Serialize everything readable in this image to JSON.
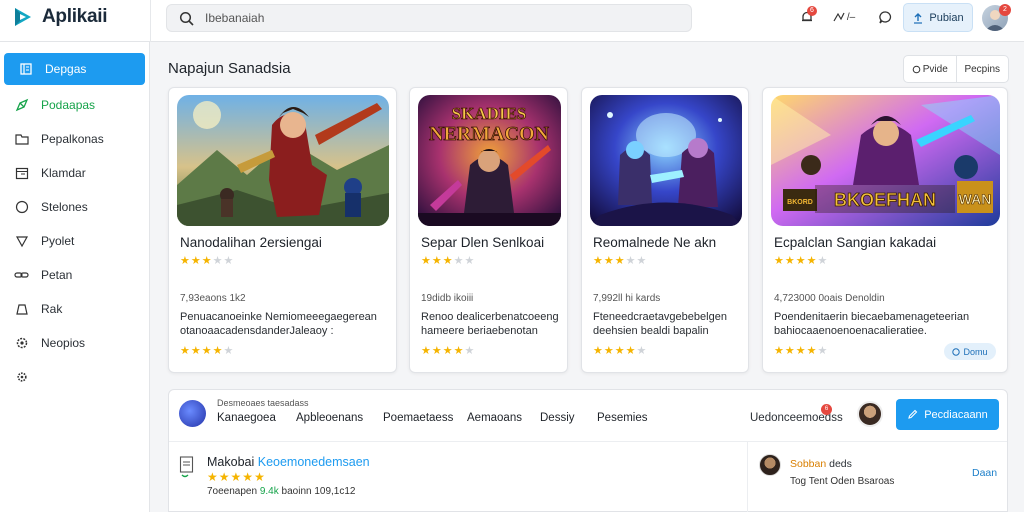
{
  "app": {
    "name": "Aplikaii"
  },
  "search": {
    "placeholder": "Ibebanaiah"
  },
  "topbar": {
    "bell_badge": "6",
    "icon_text": "/–",
    "upload_label": "Pubian",
    "avatar_badge": "2"
  },
  "sidebar": {
    "items": [
      {
        "label": "Depgas",
        "icon": "book-icon"
      },
      {
        "label": "Podaapas",
        "icon": "send-icon"
      },
      {
        "label": "Pepalkonas",
        "icon": "folder-icon"
      },
      {
        "label": "Klamdar",
        "icon": "calendar-icon"
      },
      {
        "label": "Stelones",
        "icon": "circle-icon"
      },
      {
        "label": "Pyolet",
        "icon": "shield-icon"
      },
      {
        "label": "Petan",
        "icon": "link-icon"
      },
      {
        "label": "Rak",
        "icon": "bag-icon"
      },
      {
        "label": "Neopios",
        "icon": "settings-icon"
      },
      {
        "label": "",
        "icon": "gear-icon"
      }
    ]
  },
  "main": {
    "title": "Napajun Sanadsia",
    "view_toggle": [
      "Pvide",
      "Pecpins"
    ]
  },
  "cards": [
    {
      "title": "Nanodalihan 2ersiengai",
      "rating": 3,
      "meta": "7,93eaons 1k2",
      "desc": [
        "Penuacanoeinke Nemiomeeegaegerean",
        "otanoaacadensdanderJaleaoy :"
      ],
      "rating2": 3.5,
      "pill": ""
    },
    {
      "title": "Separ Dlen Senlkoai",
      "rating": 2.5,
      "meta": "19didb ikoiii",
      "desc": [
        "Renoo dealicerbenatcoeeng",
        "hameere beriaebenotan"
      ],
      "rating2": 3.5,
      "pill": ""
    },
    {
      "title": "Reomalnede Ne akn",
      "rating": 3,
      "meta": "7,992ll hi kards",
      "desc": [
        "Fteneedcraetavgebebelgen",
        "deehsien bealdi bapalin"
      ],
      "rating2": 3.5,
      "pill": ""
    },
    {
      "title": "Ecpalclan Sangian kakadai",
      "rating": 3.5,
      "meta": "4,723000 0oais Denoldin",
      "desc": [
        "Poendenitaerin biecaebamenageteerian",
        "bahiocaaenoenoenacalieratiee."
      ],
      "rating2": 3.5,
      "pill": "Domu"
    }
  ],
  "art": {
    "card2_line1": "SKADIES",
    "card2_line2": "NERMACON",
    "card4_banner": "BKOEFHAN",
    "card4_logo": "WAN",
    "card4_small": "BKORD"
  },
  "panel": {
    "caption": "Desmeoaes taesadass",
    "tabs": [
      "Kanaegoea",
      "Apbleoenans",
      "Poemaetaess",
      "Aemaoans",
      "Dessiy",
      "Pesemies"
    ],
    "notif_label": "Uedonceemoedss",
    "notif_badge": "6",
    "primary_label": "Pecdiacaann",
    "item": {
      "title": "Makobai",
      "link": "Keoemonedemsaen",
      "rating": 5,
      "meta_prefix": "7oeenapen",
      "meta_count": "9.4k",
      "meta_suffix": "baoinn 109,1c12"
    },
    "review": {
      "name": "Sobban",
      "name_rest": "deds",
      "sub": "Tog  Tent  Oden  Bsaroas",
      "action": "Daan"
    }
  },
  "colors": {
    "accent": "#1d9bf0",
    "star": "#f5b400",
    "badge": "#e5483f",
    "download": "#16a34a"
  }
}
